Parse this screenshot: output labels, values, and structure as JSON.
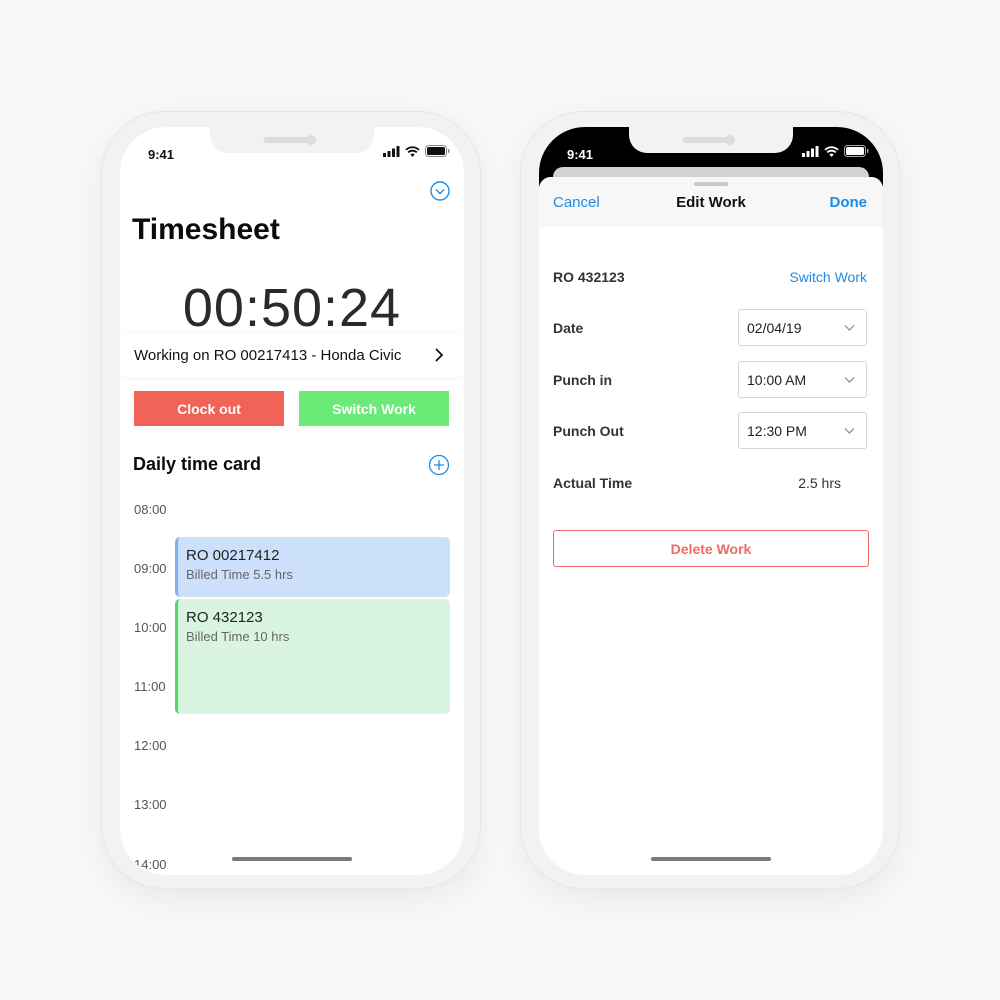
{
  "left_phone": {
    "status_time": "9:41",
    "title": "Timesheet",
    "timer": "00:50:24",
    "working_on": "Working on RO 00217413 - Honda Civic",
    "clock_out_label": "Clock out",
    "switch_work_label": "Switch Work",
    "section_title": "Daily time card",
    "time_labels": [
      "08:00",
      "09:00",
      "10:00",
      "11:00",
      "12:00",
      "13:00",
      "14:00"
    ],
    "entries": [
      {
        "title": "RO 00217412",
        "subtitle": "Billed Time 5.5 hrs"
      },
      {
        "title": "RO 432123",
        "subtitle": "Billed Time 10 hrs"
      }
    ],
    "colors": {
      "clock_out": "#f16257",
      "switch_work": "#6bea78",
      "entry_blue": "#cce0fc",
      "entry_green": "#d9f5df",
      "accent": "#1a8ce8"
    }
  },
  "right_phone": {
    "status_time": "9:41",
    "nav": {
      "cancel": "Cancel",
      "title": "Edit Work",
      "done": "Done"
    },
    "ro": "RO 432123",
    "switch_work_link": "Switch Work",
    "fields": [
      {
        "label": "Date",
        "value": "02/04/19"
      },
      {
        "label": "Punch in",
        "value": "10:00 AM"
      },
      {
        "label": "Punch Out",
        "value": "12:30 PM"
      }
    ],
    "actual_time_label": "Actual Time",
    "actual_time_value": "2.5 hrs",
    "delete_label": "Delete Work",
    "colors": {
      "accent": "#1a8ce8",
      "danger": "#ef6a63"
    }
  },
  "icons": {
    "collapse": "chevron-down-circle-icon",
    "add": "plus-circle-icon",
    "row_chevron": "chevron-right-icon",
    "select_chevron": "chevron-down-icon",
    "signal": "signal-icon",
    "wifi": "wifi-icon",
    "battery": "battery-icon"
  }
}
